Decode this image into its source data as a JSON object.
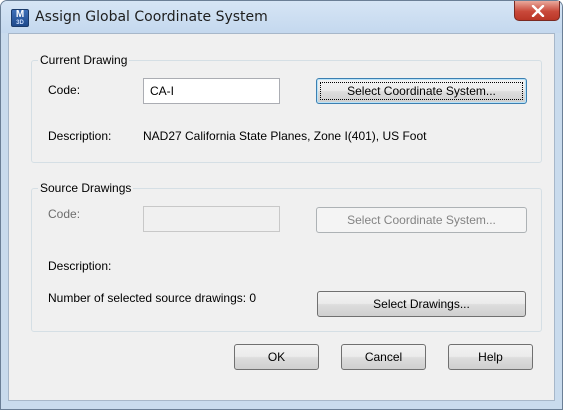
{
  "window": {
    "title": "Assign Global Coordinate System",
    "app_icon_top": "M",
    "app_icon_bottom": "3D"
  },
  "current_drawing": {
    "group_label": "Current Drawing",
    "code_label": "Code:",
    "code_value": "CA-I",
    "select_button": "Select Coordinate System...",
    "description_label": "Description:",
    "description_value": "NAD27 California State Planes, Zone I(401), US Foot"
  },
  "source_drawings": {
    "group_label": "Source Drawings",
    "code_label": "Code:",
    "code_value": "",
    "select_button": "Select Coordinate System...",
    "description_label": "Description:",
    "selected_count_label": "Number of selected source drawings: 0",
    "select_drawings_button": "Select Drawings..."
  },
  "buttons": {
    "ok": "OK",
    "cancel": "Cancel",
    "help": "Help"
  }
}
